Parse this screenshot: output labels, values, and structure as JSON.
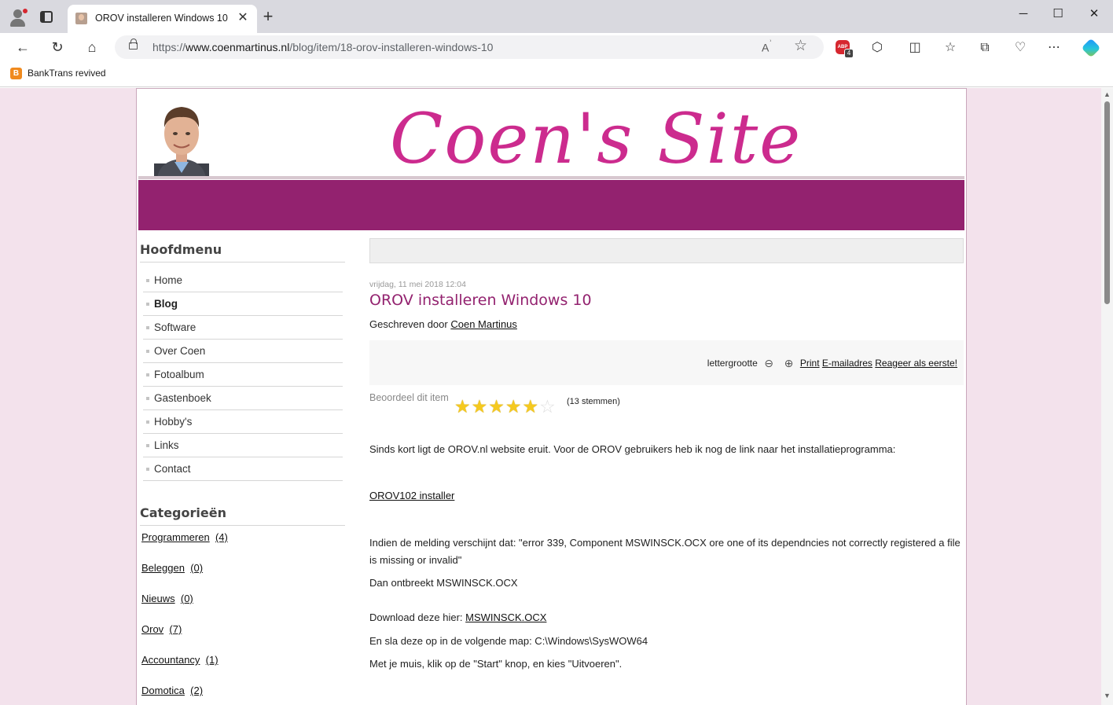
{
  "browser": {
    "tab_title": "OROV installeren Windows 10",
    "url_scheme": "https://",
    "url_host": "www.coenmartinus.nl",
    "url_path": "/blog/item/18-orov-installeren-windows-10",
    "adblock_count": "4",
    "bookmark_label": "BankTrans revived"
  },
  "site": {
    "logo_text": "Coen's Site"
  },
  "sidebar": {
    "menu_heading": "Hoofdmenu",
    "menu": [
      "Home",
      "Blog",
      "Software",
      "Over Coen",
      "Fotoalbum",
      "Gastenboek",
      "Hobby's",
      "Links",
      "Contact"
    ],
    "active_item": "Blog",
    "categories_heading": "Categorieën",
    "categories": [
      {
        "name": "Programmeren",
        "count": "(4)"
      },
      {
        "name": "Beleggen",
        "count": "(0)"
      },
      {
        "name": "Nieuws",
        "count": "(0)"
      },
      {
        "name": "Orov",
        "count": "(7)"
      },
      {
        "name": "Accountancy",
        "count": "(1)"
      },
      {
        "name": "Domotica",
        "count": "(2)"
      }
    ]
  },
  "article": {
    "date": "vrijdag, 11 mei 2018 12:04",
    "title": "OROV installeren Windows 10",
    "written_by": "Geschreven door",
    "author": "Coen Martinus",
    "font_size_label": "lettergrootte",
    "print_label": "Print",
    "email_label": "E-mailadres",
    "comment_label": "Reageer als eerste!",
    "rate_label": "Beoordeel dit item",
    "rating": 5,
    "rating_max": 6,
    "votes": "(13 stemmen)",
    "p1": "Sinds kort ligt de OROV.nl website eruit. Voor de OROV gebruikers heb ik nog de link naar het installatieprogramma:",
    "installer_link": "OROV102 installer",
    "p2": "Indien de melding verschijnt dat: \"error 339, Component MSWINSCK.OCX ore one of its dependncies not correctly registered a file is missing or invalid\"",
    "p3": "Dan ontbreekt MSWINSCK.OCX",
    "p4_prefix": "Download deze hier:",
    "p4_link": "MSWINSCK.OCX",
    "p5": "En sla deze op in de volgende map: C:\\Windows\\SysWOW64",
    "p6": "Met je muis, klik op de \"Start\" knop, en kies \"Uitvoeren\"."
  },
  "colors": {
    "brand": "#93226f",
    "logo": "#cc2b8e",
    "page_bg": "#f3e2ec"
  }
}
